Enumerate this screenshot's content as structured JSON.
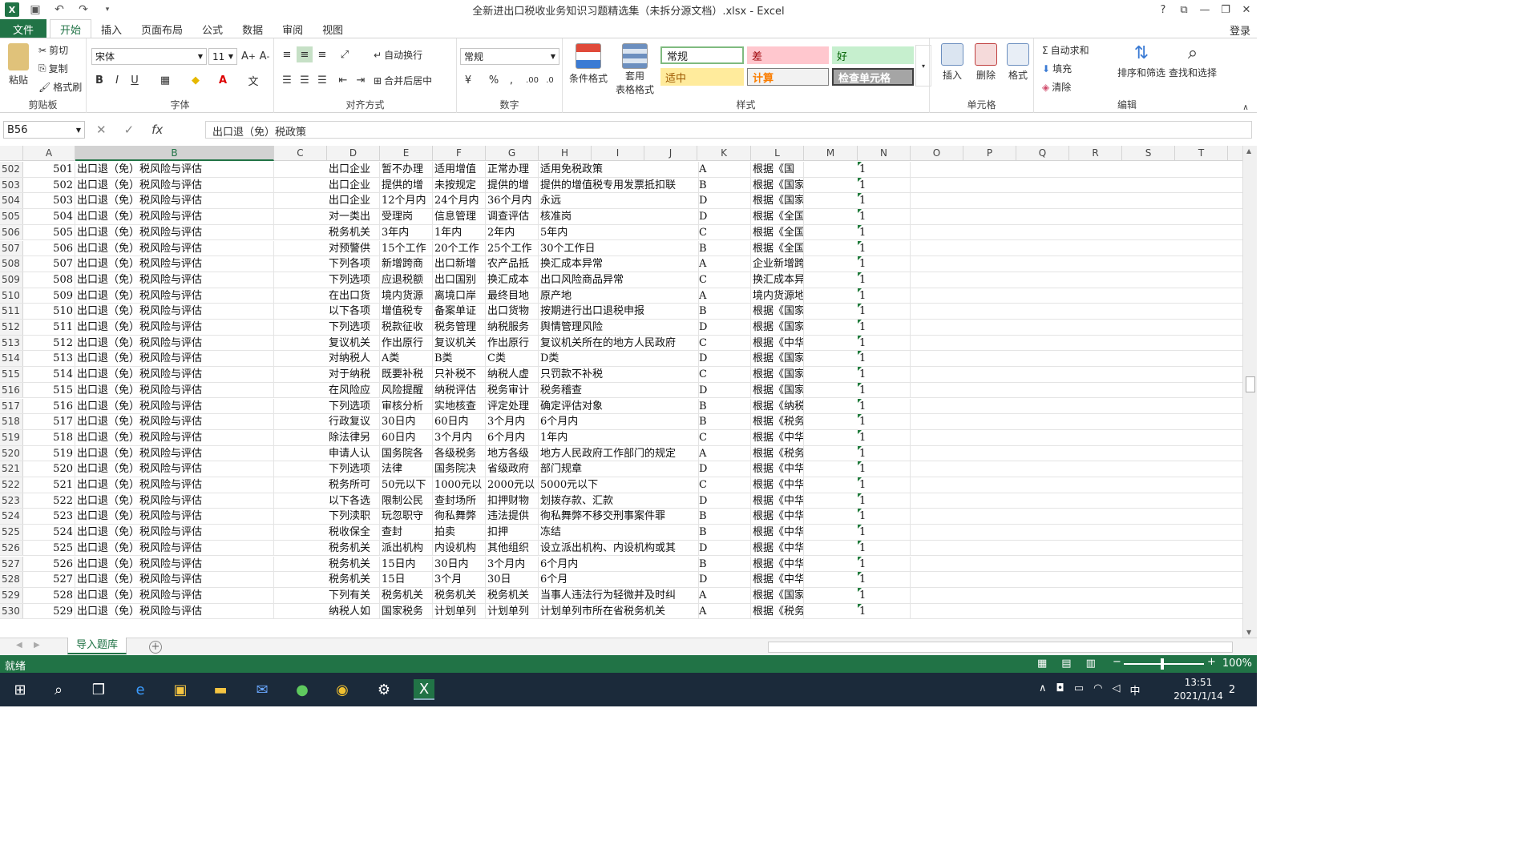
{
  "window": {
    "title": "全新进出口税收业务知识习题精选集（未拆分源文档）.xlsx - Excel",
    "help": "?",
    "login": "登录"
  },
  "tabs": [
    "文件",
    "开始",
    "插入",
    "页面布局",
    "公式",
    "数据",
    "审阅",
    "视图"
  ],
  "ribbon": {
    "clipboard": {
      "paste": "粘贴",
      "cut": "剪切",
      "copy": "复制",
      "format_painter": "格式刷",
      "label": "剪贴板"
    },
    "font": {
      "name": "宋体",
      "size": "11",
      "label": "字体",
      "bold": "B",
      "italic": "I",
      "underline": "U"
    },
    "align": {
      "wrap": "自动换行",
      "merge": "合并后居中",
      "label": "对齐方式"
    },
    "number": {
      "format": "常规",
      "label": "数字",
      "percent": "%"
    },
    "styles": {
      "conditional": "条件格式",
      "table_l1": "套用",
      "table_l2": "表格格式",
      "normal": "常规",
      "bad": "差",
      "good": "好",
      "neutral": "适中",
      "calc": "计算",
      "check": "检查单元格",
      "label": "样式"
    },
    "cells": {
      "insert": "插入",
      "delete": "删除",
      "format": "格式",
      "label": "单元格"
    },
    "editing": {
      "autosum": "自动求和",
      "fill": "填充",
      "clear": "清除",
      "sort": "排序和筛选",
      "find": "查找和选择",
      "label": "编辑"
    }
  },
  "formula_bar": {
    "name_box": "B56",
    "content": "出口退（免）税政策"
  },
  "columns": [
    "A",
    "B",
    "C",
    "D",
    "E",
    "F",
    "G",
    "H",
    "I",
    "J",
    "K",
    "L",
    "M",
    "N",
    "O",
    "P",
    "Q",
    "R",
    "S",
    "T"
  ],
  "rows": [
    {
      "r": "502",
      "a": "501",
      "b": "出口退（免）税风险与评估",
      "d": "出口企业",
      "e": "暂不办理",
      "f": "适用增值",
      "g": "正常办理",
      "h": "适用免税政策",
      "k": "A",
      "l": "根据《国",
      "n": "1"
    },
    {
      "r": "503",
      "a": "502",
      "b": "出口退（免）税风险与评估",
      "d": "出口企业",
      "e": "提供的增",
      "f": "未按规定",
      "g": "提供的增",
      "h": "提供的增值税专用发票抵扣联",
      "k": "B",
      "l": "根据《国家税务总局",
      "n": "1"
    },
    {
      "r": "504",
      "a": "503",
      "b": "出口退（免）税风险与评估",
      "d": "出口企业",
      "e": "12个月内",
      "f": "24个月内",
      "g": "36个月内",
      "h": "永远",
      "k": "D",
      "l": "根据《国家税务总局",
      "n": "1"
    },
    {
      "r": "505",
      "a": "504",
      "b": "出口退（免）税风险与评估",
      "d": "对一类出",
      "e": "受理岗",
      "f": "信息管理",
      "g": "调查评估",
      "h": "核准岗",
      "k": "D",
      "l": "根据《全国税务机关",
      "n": "1"
    },
    {
      "r": "506",
      "a": "505",
      "b": "出口退（免）税风险与评估",
      "d": "税务机关",
      "e": "3年内",
      "f": "1年内",
      "g": "2年内",
      "h": "5年内",
      "k": "C",
      "l": "根据《全国税务机关",
      "n": "1"
    },
    {
      "r": "507",
      "a": "506",
      "b": "出口退（免）税风险与评估",
      "d": "对预警供",
      "e": "15个工作",
      "f": "20个工作",
      "g": "25个工作",
      "h": "30个工作日",
      "k": "B",
      "l": "根据《全国税务机关",
      "n": "1"
    },
    {
      "r": "508",
      "a": "507",
      "b": "出口退（免）税风险与评估",
      "d": "下列各项",
      "e": "新增跨商",
      "f": "出口新增",
      "g": "农产品抵",
      "h": "换汇成本异常",
      "k": "A",
      "l": "企业新增跨商品大类",
      "n": "1"
    },
    {
      "r": "509",
      "a": "508",
      "b": "出口退（免）税风险与评估",
      "d": "下列选项",
      "e": "应退税额",
      "f": "出口国别",
      "g": "换汇成本",
      "h": "出口风险商品异常",
      "k": "C",
      "l": "换汇成本异常是准确",
      "n": "1"
    },
    {
      "r": "510",
      "a": "509",
      "b": "出口退（免）税风险与评估",
      "d": "在出口货",
      "e": "境内货源",
      "f": "离境口岸",
      "g": "最终目地",
      "h": "原产地",
      "k": "A",
      "l": "境内货源地一般表示",
      "n": "1"
    },
    {
      "r": "511",
      "a": "510",
      "b": "出口退（免）税风险与评估",
      "d": "以下各项",
      "e": "增值税专",
      "f": "备案单证",
      "g": "出口货物",
      "h": "按期进行出口退税申报",
      "k": "B",
      "l": "根据《国家税务总局",
      "n": "1"
    },
    {
      "r": "512",
      "a": "511",
      "b": "出口退（免）税风险与评估",
      "d": "下列选项",
      "e": "税款征收",
      "f": "税务管理",
      "g": "纳税服务",
      "h": "舆情管理风险",
      "k": "D",
      "l": "根据《国家税务总局",
      "n": "1"
    },
    {
      "r": "513",
      "a": "512",
      "b": "出口退（免）税风险与评估",
      "d": "复议机关",
      "e": "作出原行",
      "f": "复议机关",
      "g": "作出原行",
      "h": "复议机关所在的地方人民政府",
      "k": "C",
      "l": "根据《中华人民共和",
      "n": "1"
    },
    {
      "r": "514",
      "a": "513",
      "b": "出口退（免）税风险与评估",
      "d": "对纳税人",
      "e": "A类",
      "f": "B类",
      "g": "C类",
      "h": "D类",
      "k": "D",
      "l": "根据《国家税务总局",
      "n": "1"
    },
    {
      "r": "515",
      "a": "514",
      "b": "出口退（免）税风险与评估",
      "d": "对于纳税",
      "e": "既要补税",
      "f": "只补税不",
      "g": "纳税人虚",
      "h": "只罚款不补税",
      "k": "C",
      "l": "根据《国家税务总局",
      "n": "1"
    },
    {
      "r": "516",
      "a": "515",
      "b": "出口退（免）税风险与评估",
      "d": "在风险应",
      "e": "风险提醒",
      "f": "纳税评估",
      "g": "税务审计",
      "h": "税务稽查",
      "k": "D",
      "l": "根据《国家税务总局",
      "n": "1"
    },
    {
      "r": "517",
      "a": "516",
      "b": "出口退（免）税风险与评估",
      "d": "下列选项",
      "e": "审核分析",
      "f": "实地核查",
      "g": "评定处理",
      "h": "确定评估对象",
      "k": "B",
      "l": "根据《纳税评估管理",
      "n": "1"
    },
    {
      "r": "518",
      "a": "517",
      "b": "出口退（免）税风险与评估",
      "d": "行政复议",
      "e": "30日内",
      "f": "60日内",
      "g": "3个月内",
      "h": "6个月内",
      "k": "B",
      "l": "根据《税务行政复议",
      "n": "1"
    },
    {
      "r": "519",
      "a": "518",
      "b": "出口退（免）税风险与评估",
      "d": "除法律另",
      "e": "60日内",
      "f": "3个月内",
      "g": "6个月内",
      "h": "1年内",
      "k": "C",
      "l": "根据《中华人民共和",
      "n": "1"
    },
    {
      "r": "520",
      "a": "519",
      "b": "出口退（免）税风险与评估",
      "d": "申请人认",
      "e": "国务院各",
      "f": "各级税务",
      "g": "地方各级",
      "h": "地方人民政府工作部门的规定",
      "k": "A",
      "l": "根据《税务行政复议",
      "n": "1"
    },
    {
      "r": "521",
      "a": "520",
      "b": "出口退（免）税风险与评估",
      "d": "下列选项",
      "e": "法律",
      "f": "国务院决",
      "g": "省级政府",
      "h": "部门规章",
      "k": "D",
      "l": "根据《中华人民共和",
      "n": "1"
    },
    {
      "r": "522",
      "a": "521",
      "b": "出口退（免）税风险与评估",
      "d": "税务所可",
      "e": "50元以下",
      "f": "1000元以",
      "g": "2000元以",
      "h": "5000元以下",
      "k": "C",
      "l": "根据《中华人民共和",
      "n": "1"
    },
    {
      "r": "523",
      "a": "522",
      "b": "出口退（免）税风险与评估",
      "d": "以下各选",
      "e": "限制公民",
      "f": "查封场所",
      "g": "扣押财物",
      "h": "划拨存款、汇款",
      "k": "D",
      "l": "根据《中华人民共和",
      "n": "1"
    },
    {
      "r": "524",
      "a": "523",
      "b": "出口退（免）税风险与评估",
      "d": "下列渎职",
      "e": "玩忽职守",
      "f": "徇私舞弊",
      "g": "违法提供",
      "h": "徇私舞弊不移交刑事案件罪",
      "k": "B",
      "l": "根据《中华人民共和",
      "n": "1"
    },
    {
      "r": "525",
      "a": "524",
      "b": "出口退（免）税风险与评估",
      "d": "税收保全",
      "e": "查封",
      "f": "拍卖",
      "g": "扣押",
      "h": "冻结",
      "k": "B",
      "l": "根据《中华人民共和",
      "n": "1"
    },
    {
      "r": "526",
      "a": "525",
      "b": "出口退（免）税风险与评估",
      "d": "税务机关",
      "e": "派出机构",
      "f": "内设机构",
      "g": "其他组织",
      "h": "设立派出机构、内设机构或其",
      "k": "D",
      "l": "根据《中华人民共和",
      "n": "1"
    },
    {
      "r": "527",
      "a": "526",
      "b": "出口退（免）税风险与评估",
      "d": "税务机关",
      "e": "15日内",
      "f": "30日内",
      "g": "3个月内",
      "h": "6个月内",
      "k": "B",
      "l": "根据《中华人民共和",
      "n": "1"
    },
    {
      "r": "528",
      "a": "527",
      "b": "出口退（免）税风险与评估",
      "d": "税务机关",
      "e": "15日",
      "f": "3个月",
      "g": "30日",
      "h": "6个月",
      "k": "D",
      "l": "根据《中华人民共和",
      "n": "1"
    },
    {
      "r": "529",
      "a": "528",
      "b": "出口退（免）税风险与评估",
      "d": "下列有关",
      "e": "税务机关",
      "f": "税务机关",
      "g": "税务机关",
      "h": "当事人违法行为轻微并及时纠",
      "k": "A",
      "l": "根据《国家税务总局",
      "n": "1"
    },
    {
      "r": "530",
      "a": "529",
      "b": "出口退（免）税风险与评估",
      "d": "纳税人如",
      "e": "国家税务",
      "f": "计划单列",
      "g": "计划单列",
      "h": "计划单列市所在省税务机关",
      "k": "A",
      "l": "根据《税务行政复议",
      "n": "1"
    }
  ],
  "sheet_tab": "导入题库",
  "status": {
    "ready": "就绪",
    "zoom": "100%"
  },
  "taskbar": {
    "time": "13:51",
    "date": "2021/1/14",
    "ime": "中",
    "notif": "2"
  }
}
